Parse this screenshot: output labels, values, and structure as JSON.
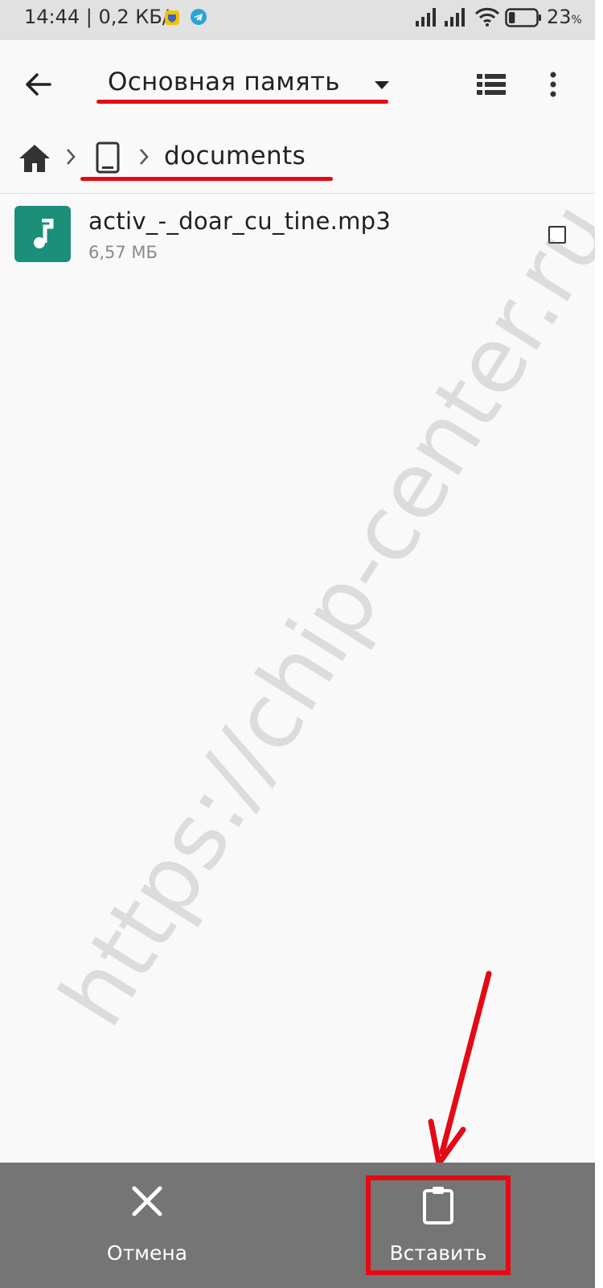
{
  "status_bar": {
    "time_speed": "14:44 | 0,2 КБ/с",
    "battery_percent": "23",
    "battery_unit": "%",
    "battery_level": 0.23
  },
  "app_bar": {
    "storage_title": "Основная память"
  },
  "breadcrumbs": {
    "current_folder": "documents"
  },
  "files": [
    {
      "name": "activ_-_doar_cu_tine.mp3",
      "size": "6,57 МБ",
      "checked": false
    }
  ],
  "watermark": "https://chip-center.ru",
  "bottom_bar": {
    "cancel_label": "Отмена",
    "paste_label": "Вставить"
  },
  "colors": {
    "annotation_red": "#e50914",
    "file_icon_bg": "#1b8f79",
    "bottom_bar_bg": "#757575",
    "status_bar_bg": "#e1e1e1"
  }
}
